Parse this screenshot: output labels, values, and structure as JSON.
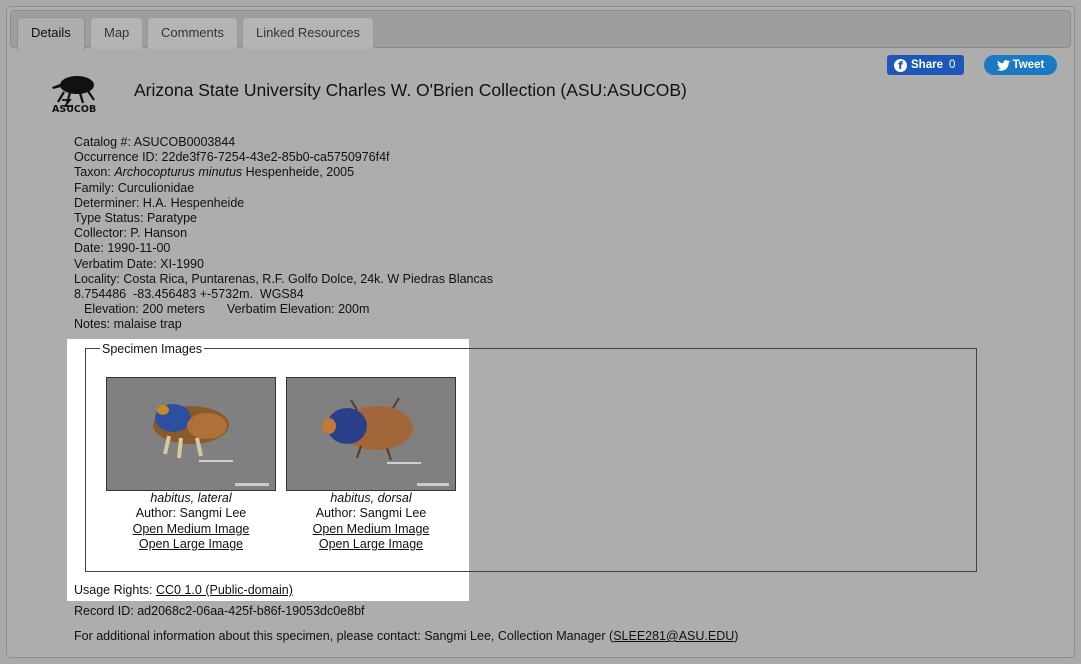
{
  "tabs": [
    "Details",
    "Map",
    "Comments",
    "Linked Resources"
  ],
  "social": {
    "share_label": "Share",
    "share_count": "0",
    "tweet_label": "Tweet"
  },
  "collection": {
    "logo_text": "ASUCOB",
    "title": "Arizona State University Charles W. O'Brien Collection (ASU:ASUCOB)"
  },
  "fields": [
    {
      "label": "Catalog #:",
      "value": "ASUCOB0003844"
    },
    {
      "label": "Occurrence ID:",
      "value": "22de3f76-7254-43e2-85b0-ca5750976f4f"
    },
    {
      "label": "Taxon:",
      "value": "Archocopturus minutus",
      "suffix": "Hespenheide, 2005"
    },
    {
      "label": "Family:",
      "value": "Curculionidae"
    },
    {
      "label": "Determiner:",
      "value": "H.A. Hespenheide"
    },
    {
      "label": "Type Status:",
      "value": "Paratype"
    },
    {
      "label": "Collector:",
      "value": "P. Hanson"
    },
    {
      "label": "Date:",
      "value": "1990-11-00"
    },
    {
      "label": "Verbatim Date:",
      "value": "XI-1990"
    },
    {
      "label": "Locality:",
      "value": "Costa Rica, Puntarenas, R.F. Golfo Dolce, 24k. W Piedras Blancas"
    },
    {
      "label": "",
      "value": "8.754486  -83.456483 +-5732m.  WGS84"
    },
    {
      "label": "Elevation:",
      "value": "200 meters",
      "extra_label": "Verbatim Elevation:",
      "extra_value": "200m"
    },
    {
      "label": "Notes:",
      "value": "malaise trap"
    }
  ],
  "specimen_images": {
    "legend": "Specimen Images",
    "images": [
      {
        "caption": "habitus, lateral",
        "author": "Author: Sangmi Lee",
        "medium": "Open Medium Image",
        "large": "Open Large Image"
      },
      {
        "caption": "habitus, dorsal",
        "author": "Author: Sangmi Lee",
        "medium": "Open Medium Image",
        "large": "Open Large Image"
      }
    ]
  },
  "usage": {
    "label": "Usage Rights:",
    "value": "CC0 1.0 (Public-domain)"
  },
  "record": {
    "label": "Record ID:",
    "value": "ad2068c2-06aa-425f-b86f-19053dc0e8bf"
  },
  "contact": {
    "text": "For additional information about this specimen, please contact: Sangmi Lee, Collection Manager (",
    "email": "SLEE281@ASU.EDU",
    "close": ")"
  },
  "colors": {
    "background": "#a9a9a9",
    "facebook": "#1d57b8",
    "twitter": "#1a7bc4",
    "highlight": "#ffffff"
  }
}
